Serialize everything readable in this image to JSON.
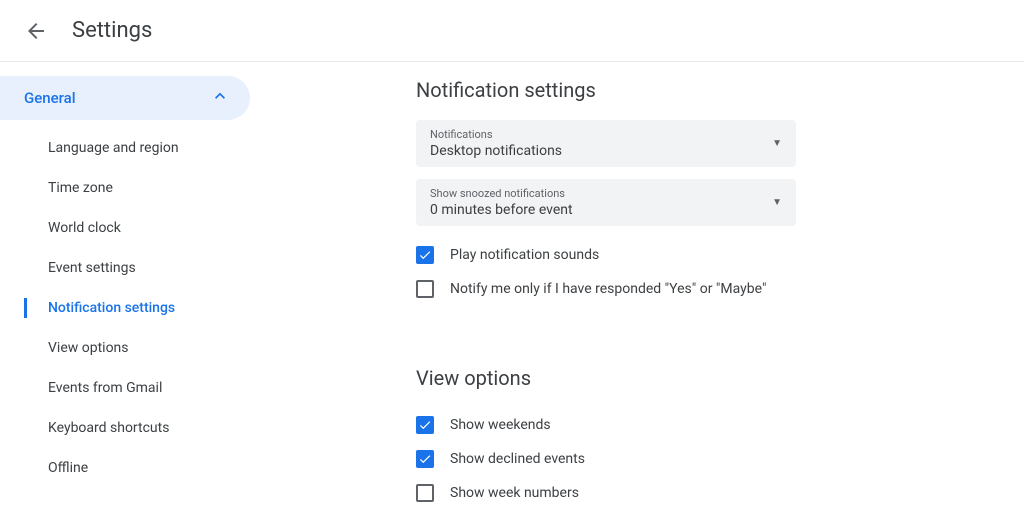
{
  "header": {
    "title": "Settings"
  },
  "sidebar": {
    "header": "General",
    "items": [
      {
        "label": "Language and region",
        "active": false
      },
      {
        "label": "Time zone",
        "active": false
      },
      {
        "label": "World clock",
        "active": false
      },
      {
        "label": "Event settings",
        "active": false
      },
      {
        "label": "Notification settings",
        "active": true
      },
      {
        "label": "View options",
        "active": false
      },
      {
        "label": "Events from Gmail",
        "active": false
      },
      {
        "label": "Keyboard shortcuts",
        "active": false
      },
      {
        "label": "Offline",
        "active": false
      }
    ]
  },
  "main": {
    "notification_section": {
      "title": "Notification settings",
      "selects": [
        {
          "label": "Notifications",
          "value": "Desktop notifications"
        },
        {
          "label": "Show snoozed notifications",
          "value": "0 minutes before event"
        }
      ],
      "checkboxes": [
        {
          "label": "Play notification sounds",
          "checked": true
        },
        {
          "label": "Notify me only if I have responded \"Yes\" or \"Maybe\"",
          "checked": false
        }
      ]
    },
    "view_section": {
      "title": "View options",
      "checkboxes": [
        {
          "label": "Show weekends",
          "checked": true
        },
        {
          "label": "Show declined events",
          "checked": true
        },
        {
          "label": "Show week numbers",
          "checked": false
        }
      ]
    }
  }
}
